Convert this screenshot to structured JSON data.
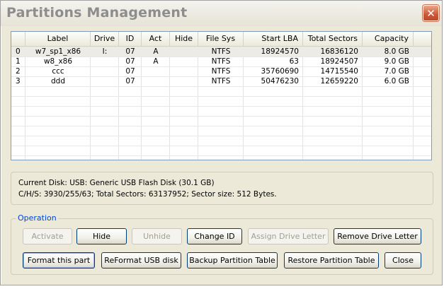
{
  "window": {
    "title": "Partitions Management",
    "close_glyph": "✕"
  },
  "partition_table": {
    "columns": [
      "",
      "Label",
      "Drive",
      "ID",
      "Act",
      "Hide",
      "File Sys",
      "Start LBA",
      "Total Sectors",
      "Capacity"
    ],
    "rows": [
      {
        "index": "0",
        "label": "w7_sp1_x86",
        "drive": "I:",
        "id": "07",
        "act": "A",
        "hide": "",
        "fs": "NTFS",
        "start": "18924570",
        "total": "16836120",
        "capacity": "8.0 GB"
      },
      {
        "index": "1",
        "label": "w8_x86",
        "drive": "",
        "id": "07",
        "act": "A",
        "hide": "",
        "fs": "NTFS",
        "start": "63",
        "total": "18924507",
        "capacity": "9.0 GB"
      },
      {
        "index": "2",
        "label": "ccc",
        "drive": "",
        "id": "07",
        "act": "",
        "hide": "",
        "fs": "NTFS",
        "start": "35760690",
        "total": "14715540",
        "capacity": "7.0 GB"
      },
      {
        "index": "3",
        "label": "ddd",
        "drive": "",
        "id": "07",
        "act": "",
        "hide": "",
        "fs": "NTFS",
        "start": "50476230",
        "total": "12659220",
        "capacity": "6.0 GB"
      }
    ]
  },
  "disk_info": {
    "line1": "Current Disk:   USB: Generic USB Flash Disk (30.1 GB)",
    "line2": "C/H/S: 3930/255/63; Total Sectors: 63137952; Sector size: 512 Bytes."
  },
  "operation": {
    "label": "Operation",
    "buttons": {
      "activate": "Activate",
      "hide": "Hide",
      "unhide": "Unhide",
      "change_id": "Change ID",
      "assign_letter": "Assign Drive Letter",
      "remove_letter": "Remove Drive Letter",
      "format_part": "Format this part",
      "reformat_usb": "ReFormat USB disk",
      "backup_table": "Backup Partition Table",
      "restore_table": "Restore Partition Table",
      "close": "Close"
    }
  }
}
